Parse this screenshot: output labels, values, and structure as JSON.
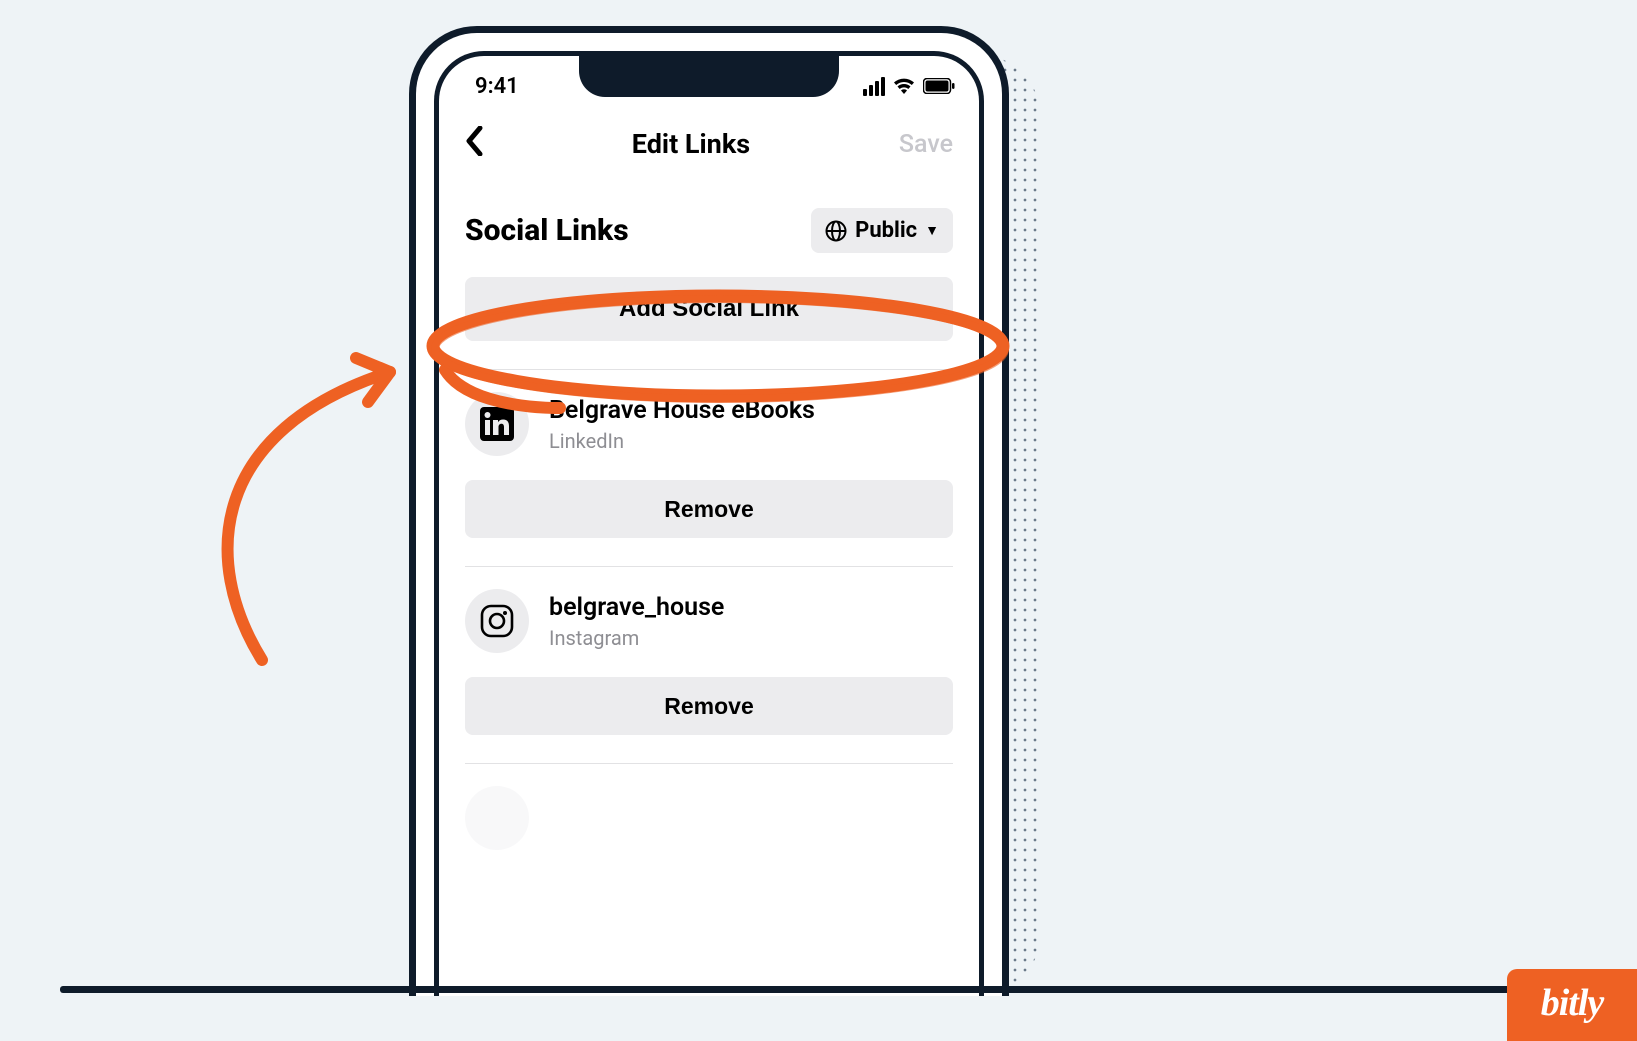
{
  "status": {
    "time": "9:41"
  },
  "nav": {
    "title": "Edit Links",
    "save_label": "Save"
  },
  "section": {
    "title": "Social Links"
  },
  "visibility": {
    "label": "Public"
  },
  "add_button": {
    "label": "Add Social Link"
  },
  "links": [
    {
      "title": "Belgrave House eBooks",
      "platform": "LinkedIn",
      "remove_label": "Remove"
    },
    {
      "title": "belgrave_house",
      "platform": "Instagram",
      "remove_label": "Remove"
    }
  ],
  "branding": {
    "bitly": "bitly"
  },
  "colors": {
    "accent": "#ee6123",
    "ink": "#0e1b2a",
    "muted_bg": "#ececee"
  }
}
